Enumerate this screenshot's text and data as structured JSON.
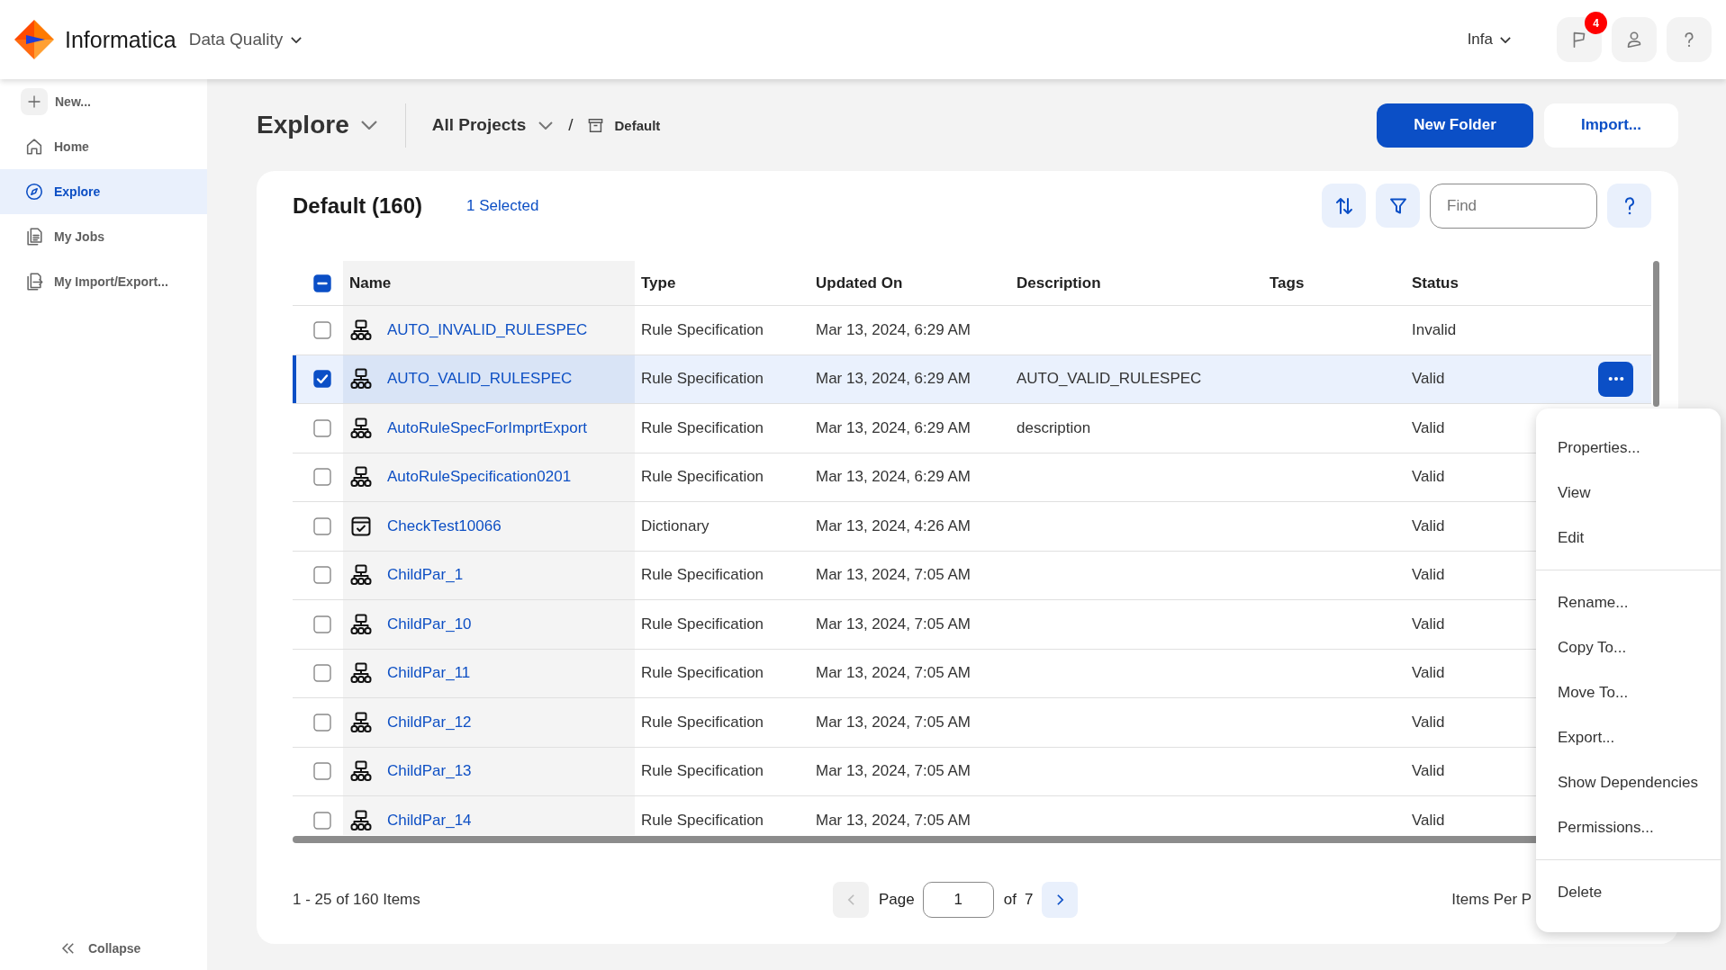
{
  "header": {
    "brand": "Informatica",
    "product": "Data Quality",
    "user": "Infa",
    "notifications": "4"
  },
  "sidebar": {
    "items": [
      {
        "label": "New...",
        "kind": "action",
        "selected": false
      },
      {
        "label": "Home",
        "kind": "link",
        "selected": false
      },
      {
        "label": "Explore",
        "kind": "link",
        "selected": true
      },
      {
        "label": "My Jobs",
        "kind": "link",
        "selected": false
      },
      {
        "label": "My Import/Export...",
        "kind": "link",
        "selected": false
      }
    ],
    "collapse": "Collapse"
  },
  "page": {
    "title": "Explore",
    "breadcrumb": {
      "items": [
        {
          "label": "All Projects",
          "kind": "dropdown"
        },
        {
          "label": "Default",
          "kind": "folder"
        }
      ],
      "separator": "/"
    },
    "buttons": [
      {
        "label": "New Folder",
        "kind": "primary"
      },
      {
        "label": "Import...",
        "kind": "secondary"
      }
    ]
  },
  "panel": {
    "title": "Default (160)",
    "selection": "1 Selected",
    "search": {
      "placeholder": "Find"
    }
  },
  "table": {
    "select_all_partial": true,
    "columns": [
      "Name",
      "Type",
      "Updated On",
      "Description",
      "Tags",
      "Status"
    ],
    "rows": [
      {
        "kind": "rule_specification",
        "name": "AUTO_INVALID_RULESPEC",
        "type": "Rule Specification",
        "updated_on": "Mar 13, 2024, 6:29 AM",
        "status": "Invalid",
        "selected": false
      },
      {
        "kind": "rule_specification",
        "name": "AUTO_VALID_RULESPEC",
        "type": "Rule Specification",
        "updated_on": "Mar 13, 2024, 6:29 AM",
        "description": "AUTO_VALID_RULESPEC",
        "status": "Valid",
        "selected": true
      },
      {
        "kind": "rule_specification",
        "name": "AutoRuleSpecForImprtExport",
        "type": "Rule Specification",
        "updated_on": "Mar 13, 2024, 6:29 AM",
        "description": "description",
        "status": "Valid",
        "selected": false
      },
      {
        "kind": "rule_specification",
        "name": "AutoRuleSpecification0201",
        "type": "Rule Specification",
        "updated_on": "Mar 13, 2024, 6:29 AM",
        "status": "Valid",
        "selected": false
      },
      {
        "kind": "dictionary",
        "name": "CheckTest10066",
        "type": "Dictionary",
        "updated_on": "Mar 13, 2024, 4:26 AM",
        "status": "Valid",
        "selected": false
      },
      {
        "kind": "rule_specification",
        "name": "ChildPar_1",
        "type": "Rule Specification",
        "updated_on": "Mar 13, 2024, 7:05 AM",
        "status": "Valid",
        "selected": false
      },
      {
        "kind": "rule_specification",
        "name": "ChildPar_10",
        "type": "Rule Specification",
        "updated_on": "Mar 13, 2024, 7:05 AM",
        "status": "Valid",
        "selected": false
      },
      {
        "kind": "rule_specification",
        "name": "ChildPar_11",
        "type": "Rule Specification",
        "updated_on": "Mar 13, 2024, 7:05 AM",
        "status": "Valid",
        "selected": false
      },
      {
        "kind": "rule_specification",
        "name": "ChildPar_12",
        "type": "Rule Specification",
        "updated_on": "Mar 13, 2024, 7:05 AM",
        "status": "Valid",
        "selected": false
      },
      {
        "kind": "rule_specification",
        "name": "ChildPar_13",
        "type": "Rule Specification",
        "updated_on": "Mar 13, 2024, 7:05 AM",
        "status": "Valid",
        "selected": false
      },
      {
        "kind": "rule_specification",
        "name": "ChildPar_14",
        "type": "Rule Specification",
        "updated_on": "Mar 13, 2024, 7:05 AM",
        "status": "Valid",
        "selected": false
      }
    ]
  },
  "pagination": {
    "summary": "1 - 25 of 160 Items",
    "page_label": "Page",
    "page": "1",
    "of_label": "of",
    "total_pages": "7",
    "previous_disabled": true,
    "next_disabled": false,
    "items_per_page_label": "Items Per P"
  },
  "context_menu": {
    "groups": [
      [
        "Properties...",
        "View",
        "Edit"
      ],
      [
        "Rename...",
        "Copy To...",
        "Move To...",
        "Export...",
        "Show Dependencies",
        "Permissions..."
      ],
      [
        "Delete"
      ]
    ]
  }
}
